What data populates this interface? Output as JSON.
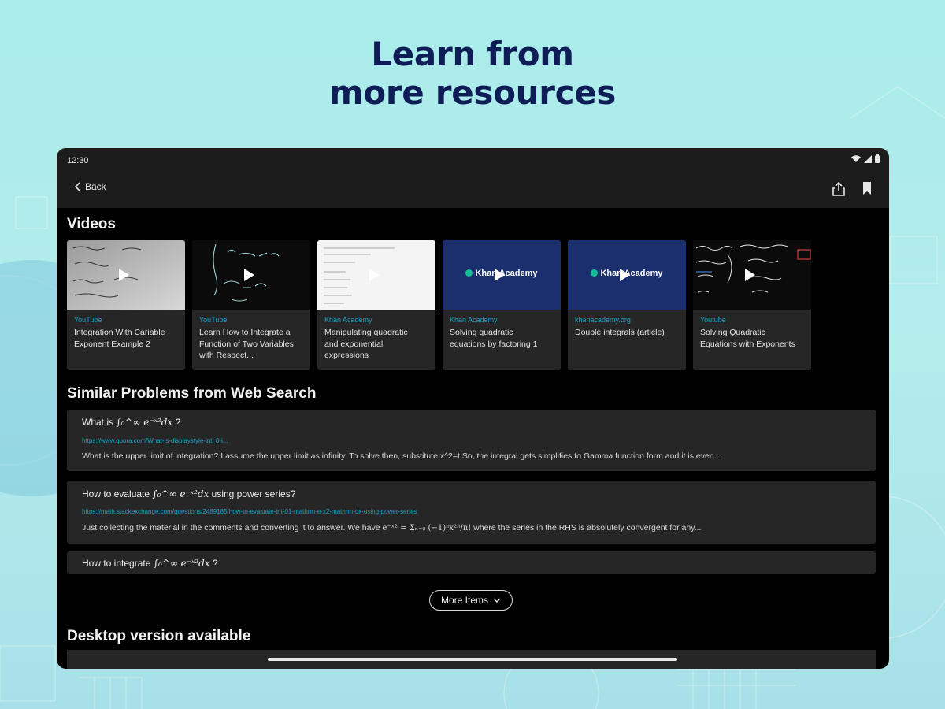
{
  "headline": {
    "line1": "Learn from",
    "line2": "more resources"
  },
  "status_bar": {
    "time": "12:30",
    "icons": [
      "wifi-icon",
      "signal-icon",
      "battery-icon"
    ]
  },
  "app_bar": {
    "back_label": "Back",
    "share_icon": "share-icon",
    "bookmark_icon": "bookmark-icon"
  },
  "videos": {
    "title": "Videos",
    "items": [
      {
        "source": "YouTube",
        "title_line1": "Integration With Cariable",
        "title_line2": "Exponent Example 2",
        "title_line3": "",
        "thumb": "whiteboard"
      },
      {
        "source": "YouTube",
        "title_line1": "Learn How to Integrate a",
        "title_line2": "Function of Two Variables",
        "title_line3": "with Respect...",
        "thumb": "blackboard"
      },
      {
        "source": "Khan Academy",
        "title_line1": "Manipulating quadratic",
        "title_line2": "and exponential",
        "title_line3": "expressions",
        "thumb": "document"
      },
      {
        "source": "Khan Academy",
        "title_line1": "Solving quadratic",
        "title_line2": "equations by factoring 1",
        "title_line3": "",
        "thumb": "khan",
        "logo_text": "Khan Academy"
      },
      {
        "source": "khanacademy.org",
        "title_line1": "Double integrals (article)",
        "title_line2": "",
        "title_line3": "",
        "thumb": "khan",
        "logo_text": "Khan Academy"
      },
      {
        "source": "Youtube",
        "title_line1": "Solving Quadratic",
        "title_line2": "Equations with Exponents",
        "title_line3": "",
        "thumb": "handwritten"
      }
    ]
  },
  "similar": {
    "title": "Similar Problems from Web Search",
    "items": [
      {
        "question_prefix": "What is",
        "question_math": "∫₀^∞ e⁻ˣ²dx",
        "question_suffix": "?",
        "url": "https://www.quora.com/What-is-displaystyle-int_0-i...",
        "snippet": "What is the upper limit of integration? I assume the upper limit as infinity. To solve then, substitute x^2=t So, the integral gets simplifies to Gamma function form and it is even..."
      },
      {
        "question_prefix": "How to evaluate",
        "question_math": "∫₀^∞ e⁻ˣ²dx",
        "question_suffix": "using power series?",
        "url": "https://math.stackexchange.com/questions/2489185/how-to-evaluate-int-01-mathrm-e-x2-mathrm-dx-using-power-series",
        "snippet_a": "Just collecting the material in the comments and converting it to answer. We have",
        "snippet_math": "e⁻ˣ² = Σₙ₌₀ (−1)ⁿx²ⁿ/n!",
        "snippet_b": "where the series in the RHS is absolutely convergent for any..."
      },
      {
        "question_prefix": "How to integrate",
        "question_math": "∫₀^∞ e⁻ˣ²dx",
        "question_suffix": "?"
      }
    ],
    "more_label": "More Items"
  },
  "desktop": {
    "title": "Desktop version available"
  }
}
